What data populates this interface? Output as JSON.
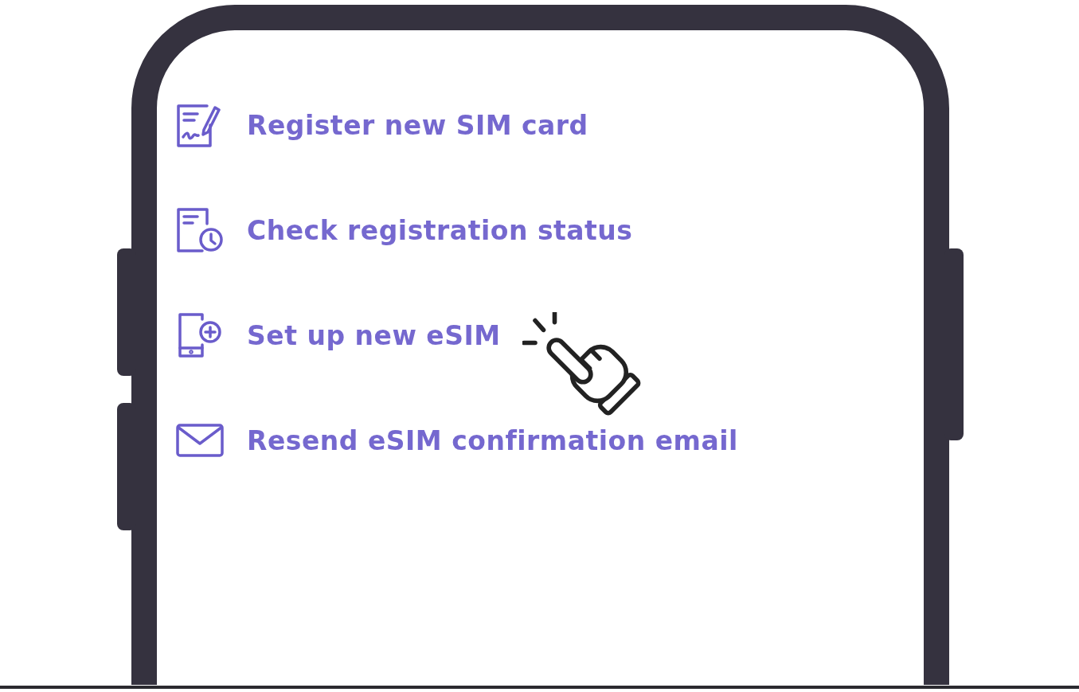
{
  "menu": {
    "items": [
      {
        "kind": "register",
        "label": "Register new SIM card"
      },
      {
        "kind": "status",
        "label": "Check registration status"
      },
      {
        "kind": "esim",
        "label": "Set up new eSIM"
      },
      {
        "kind": "email",
        "label": "Resend eSIM confirmation email"
      }
    ]
  }
}
